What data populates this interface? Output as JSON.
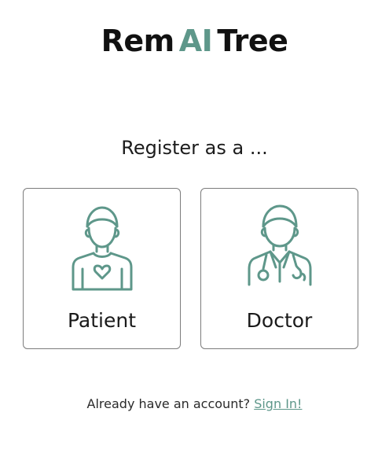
{
  "brand": {
    "prefix": "Rem",
    "accent": "AI",
    "suffix": "Tree",
    "accent_color": "#5e978a"
  },
  "register_heading": "Register as a ...",
  "roles": [
    {
      "label": "Patient",
      "icon": "patient-icon"
    },
    {
      "label": "Doctor",
      "icon": "doctor-icon"
    }
  ],
  "footer": {
    "prompt": "Already have an account?",
    "link_label": "Sign In!"
  },
  "colors": {
    "accent": "#5e978a",
    "icon_stroke": "#5e978a",
    "card_border": "#7c7c7c"
  }
}
